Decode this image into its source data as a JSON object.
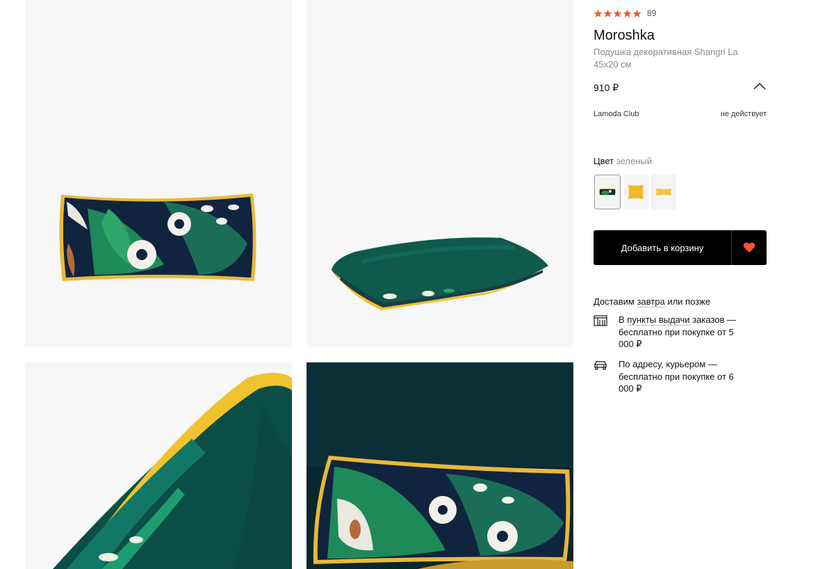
{
  "gallery": {
    "images": [
      {
        "name": "front-pillow-image"
      },
      {
        "name": "side-pillow-image"
      },
      {
        "name": "closeup-pillow-image"
      },
      {
        "name": "interior-pillow-image"
      }
    ]
  },
  "product": {
    "rating_stars": 5,
    "review_count": "89",
    "brand": "Moroshka",
    "name": "Подушка декоративная Shangri La 45x20 см",
    "price": "910 ₽",
    "club_label": "Lamoda Club",
    "club_status": "не действует",
    "color_label": "Цвет",
    "color_value": "зеленый",
    "swatches": [
      {
        "color": "green",
        "selected": true
      },
      {
        "color": "yellow",
        "selected": false
      },
      {
        "color": "yellow-light",
        "selected": false
      }
    ],
    "add_to_cart_label": "Добавить в корзину"
  },
  "delivery": {
    "head_pre": "Доставим",
    "head_link": "завтра",
    "head_post": "или позже",
    "pickup_pre": "В",
    "pickup_link": "пункты выдачи",
    "pickup_post": "заказов — бесплатно при покупке от 5 000 ₽",
    "courier_text": "По адресу, курьером — бесплатно при покупке от 6 000 ₽"
  },
  "colors": {
    "star": "#f5542e",
    "heart": "#f5542e",
    "button_bg": "#000000",
    "pillow_green": "#0f5a4b",
    "piping_yellow": "#f0c22e"
  },
  "icons": [
    "star-icon",
    "chevron-up-icon",
    "heart-icon",
    "pickup-point-icon",
    "car-icon"
  ]
}
